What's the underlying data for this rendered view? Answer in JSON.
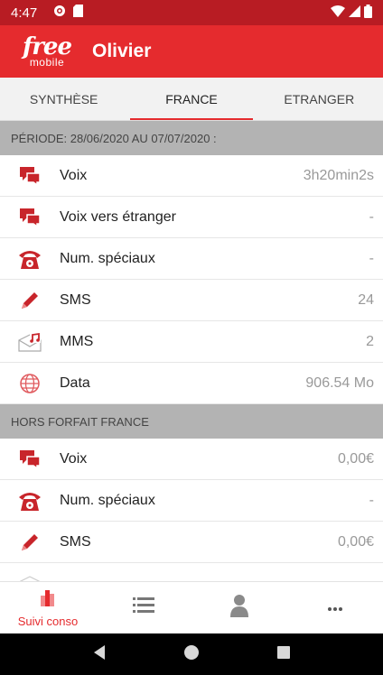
{
  "status_bar": {
    "time": "4:47"
  },
  "header": {
    "logo_top": "free",
    "logo_bottom": "mobile",
    "title": "Olivier"
  },
  "tabs": [
    {
      "label": "SYNTHÈSE",
      "active": false
    },
    {
      "label": "FRANCE",
      "active": true
    },
    {
      "label": "ETRANGER",
      "active": false
    }
  ],
  "sections": [
    {
      "title": "PÉRIODE: 28/06/2020 AU 07/07/2020 :",
      "rows": [
        {
          "icon": "chat-bubble-icon",
          "label": "Voix",
          "value": "3h20min2s"
        },
        {
          "icon": "chat-bubble-icon",
          "label": "Voix vers étranger",
          "value": "-"
        },
        {
          "icon": "telephone-icon",
          "label": "Num. spéciaux",
          "value": "-"
        },
        {
          "icon": "pencil-icon",
          "label": "SMS",
          "value": "24"
        },
        {
          "icon": "music-envelope-icon",
          "label": "MMS",
          "value": "2"
        },
        {
          "icon": "globe-icon",
          "label": "Data",
          "value": "906.54 Mo"
        }
      ]
    },
    {
      "title": "HORS FORFAIT FRANCE",
      "rows": [
        {
          "icon": "chat-bubble-icon",
          "label": "Voix",
          "value": "0,00€"
        },
        {
          "icon": "telephone-icon",
          "label": "Num. spéciaux",
          "value": "-"
        },
        {
          "icon": "pencil-icon",
          "label": "SMS",
          "value": "0,00€"
        }
      ]
    }
  ],
  "bottom_nav": {
    "suivi_label": "Suivi conso"
  },
  "colors": {
    "accent": "#e52b2e",
    "status_bar": "#b81c23",
    "section": "#b3b3b3"
  }
}
